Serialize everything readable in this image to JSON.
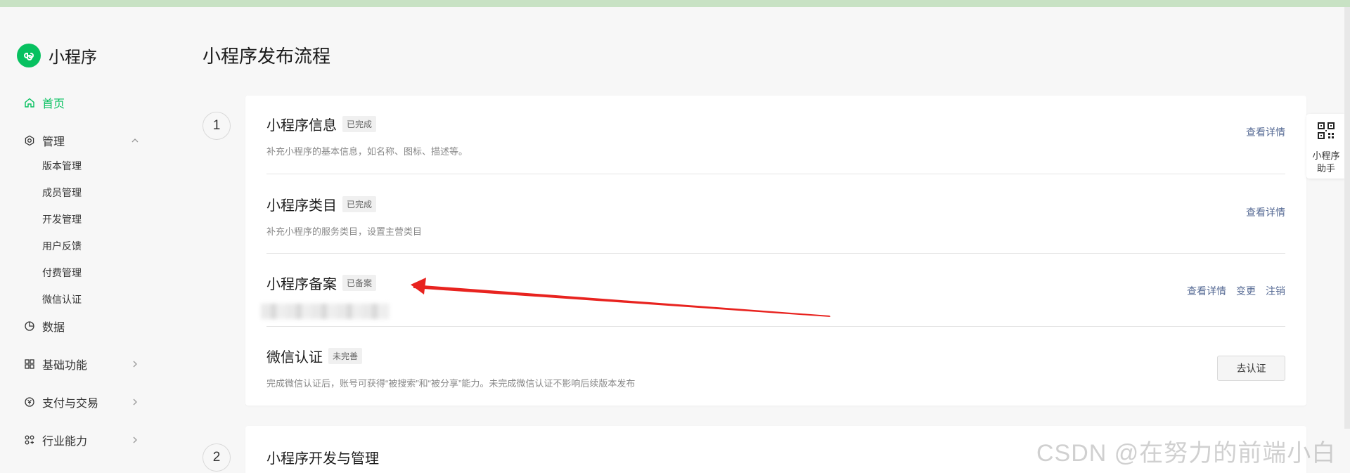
{
  "app": {
    "name": "小程序"
  },
  "sidebar": {
    "items": [
      {
        "label": "首页",
        "icon": "home-icon",
        "active": true
      },
      {
        "label": "管理",
        "icon": "settings-icon",
        "expanded": true
      },
      {
        "label": "数据",
        "icon": "chart-pie-icon"
      },
      {
        "label": "基础功能",
        "icon": "grid-icon"
      },
      {
        "label": "支付与交易",
        "icon": "yuan-icon"
      },
      {
        "label": "行业能力",
        "icon": "industry-icon"
      }
    ],
    "sub_items": [
      "版本管理",
      "成员管理",
      "开发管理",
      "用户反馈",
      "付费管理",
      "微信认证"
    ]
  },
  "main": {
    "title": "小程序发布流程",
    "steps": [
      {
        "number": "1",
        "rows": [
          {
            "title": "小程序信息",
            "badge": "已完成",
            "desc": "补充小程序的基本信息，如名称、图标、描述等。",
            "actions": [
              "查看详情"
            ]
          },
          {
            "title": "小程序类目",
            "badge": "已完成",
            "desc": "补充小程序的服务类目，设置主营类目",
            "actions": [
              "查看详情"
            ]
          },
          {
            "title": "小程序备案",
            "badge": "已备案",
            "desc": "",
            "actions": [
              "查看详情",
              "变更",
              "注销"
            ]
          },
          {
            "title": "微信认证",
            "badge": "未完善",
            "desc": "完成微信认证后，账号可获得“被搜索”和“被分享”能力。未完成微信认证不影响后续版本发布",
            "button": "去认证"
          }
        ]
      },
      {
        "number": "2",
        "title": "小程序开发与管理"
      }
    ]
  },
  "helper": {
    "label": "小程序助手"
  },
  "watermark": "CSDN @在努力的前端小白",
  "colors": {
    "brand": "#07c160",
    "link": "#576b95",
    "annotation_arrow": "#e8231f"
  }
}
